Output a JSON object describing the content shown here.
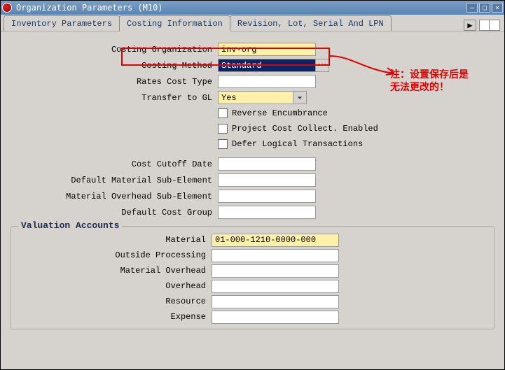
{
  "window": {
    "title": "Organization Parameters (M10)"
  },
  "tabs": [
    "Inventory Parameters",
    "Costing Information",
    "Revision, Lot, Serial And LPN"
  ],
  "active_tab_index": 1,
  "fields": {
    "costing_org": {
      "label": "Costing Organization",
      "value": "inv-org"
    },
    "costing_method": {
      "label": "Costing Method",
      "value": "Standard"
    },
    "rates_cost_type": {
      "label": "Rates Cost Type",
      "value": ""
    },
    "transfer_to_gl": {
      "label": "Transfer to GL",
      "value": "Yes"
    },
    "reverse_encumbrance": {
      "label": "Reverse Encumbrance"
    },
    "project_cost_collect": {
      "label": "Project Cost Collect. Enabled"
    },
    "defer_logical": {
      "label": "Defer Logical Transactions"
    },
    "cost_cutoff_date": {
      "label": "Cost Cutoff Date",
      "value": ""
    },
    "def_material_subel": {
      "label": "Default Material Sub-Element",
      "value": ""
    },
    "mat_overhead_subel": {
      "label": "Material Overhead Sub-Element",
      "value": ""
    },
    "default_cost_group": {
      "label": "Default Cost Group",
      "value": ""
    }
  },
  "valuation_accounts": {
    "title": "Valuation Accounts",
    "rows": {
      "material": {
        "label": "Material",
        "value": "01-000-1210-0000-000"
      },
      "outside_processing": {
        "label": "Outside Processing",
        "value": ""
      },
      "material_overhead": {
        "label": "Material Overhead",
        "value": ""
      },
      "overhead": {
        "label": "Overhead",
        "value": ""
      },
      "resource": {
        "label": "Resource",
        "value": ""
      },
      "expense": {
        "label": "Expense",
        "value": ""
      }
    }
  },
  "annotation": {
    "line1": "注：设置保存后是",
    "line2": "无法更改的！"
  },
  "scroll_glyph": "▶"
}
